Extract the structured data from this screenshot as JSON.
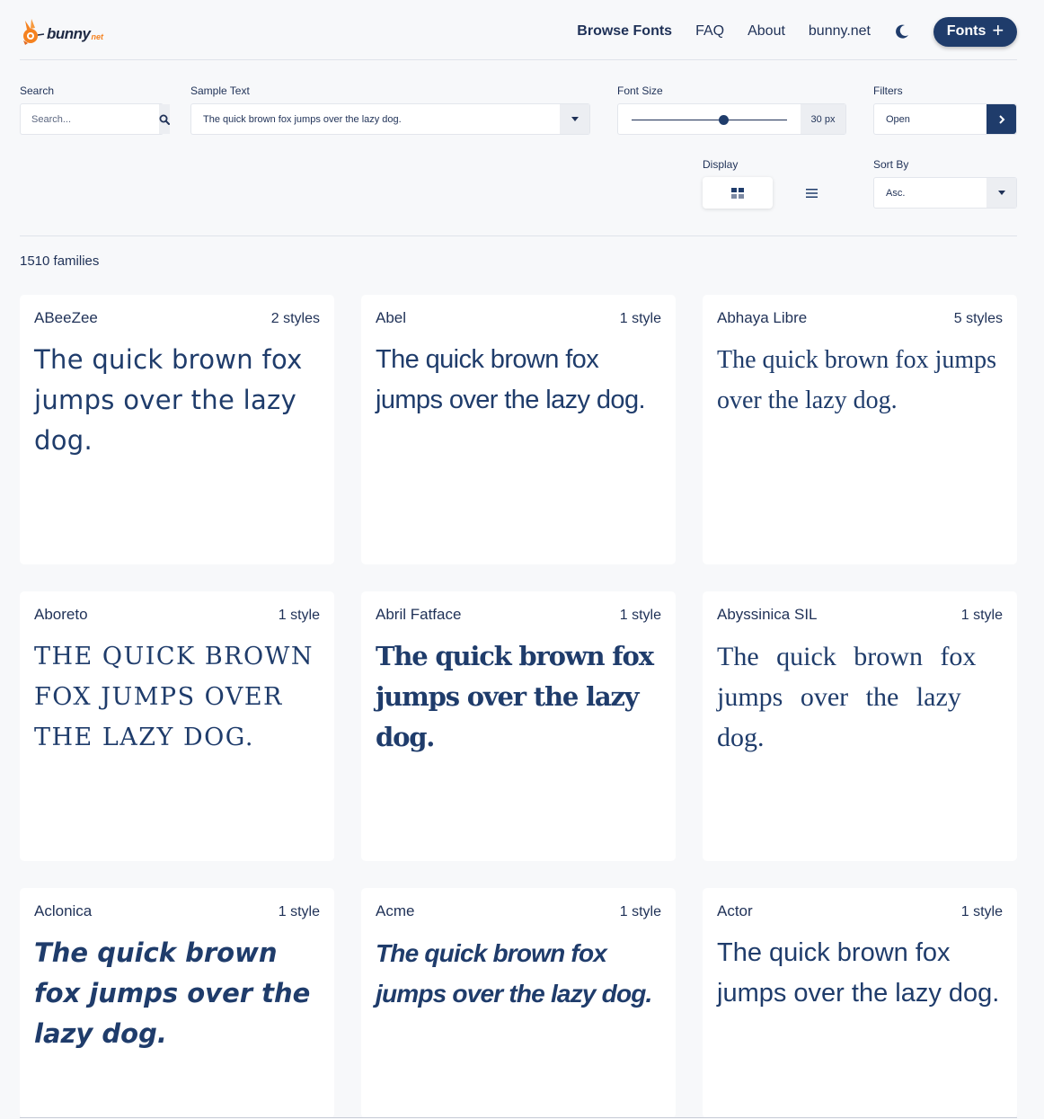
{
  "header": {
    "logo_text": "bunny",
    "logo_suffix": "net",
    "nav": [
      "Browse Fonts",
      "FAQ",
      "About",
      "bunny.net"
    ],
    "theme_icon": "moon-icon",
    "fonts_button": "Fonts",
    "fonts_button_icon": "plus-icon"
  },
  "controls": {
    "search_label": "Search",
    "search_placeholder": "Search...",
    "sample_label": "Sample Text",
    "sample_value": "The quick brown fox jumps over the lazy dog.",
    "size_label": "Font Size",
    "size_value": "30 px",
    "size_fraction": 0.59,
    "filters_label": "Filters",
    "filters_value": "Open",
    "display_label": "Display",
    "sort_label": "Sort By",
    "sort_value": "Asc."
  },
  "count": "1510 families",
  "colors": {
    "accent": "#1f3c6b",
    "text": "#1f3157",
    "brand_orange": "#f58220",
    "background": "#f7f8fa"
  },
  "cards": [
    {
      "name": "ABeeZee",
      "styles": "2 styles",
      "sample": "The quick brown fox jumps over the lazy dog."
    },
    {
      "name": "Abel",
      "styles": "1 style",
      "sample": "The quick brown fox jumps over the lazy dog."
    },
    {
      "name": "Abhaya Libre",
      "styles": "5 styles",
      "sample": "The quick brown fox jumps over the lazy dog."
    },
    {
      "name": "Aboreto",
      "styles": "1 style",
      "sample": "THE QUICK BROWN FOX JUMPS OVER THE LAZY DOG."
    },
    {
      "name": "Abril Fatface",
      "styles": "1 style",
      "sample": "The quick brown fox jumps over the lazy dog."
    },
    {
      "name": "Abyssinica SIL",
      "styles": "1 style",
      "sample": "The quick brown fox jumps over the lazy dog."
    },
    {
      "name": "Aclonica",
      "styles": "1 style",
      "sample": "The quick brown fox jumps over the lazy dog."
    },
    {
      "name": "Acme",
      "styles": "1 style",
      "sample": "The quick brown fox jumps over the lazy dog."
    },
    {
      "name": "Actor",
      "styles": "1 style",
      "sample": "The quick brown fox jumps over the lazy dog."
    }
  ]
}
